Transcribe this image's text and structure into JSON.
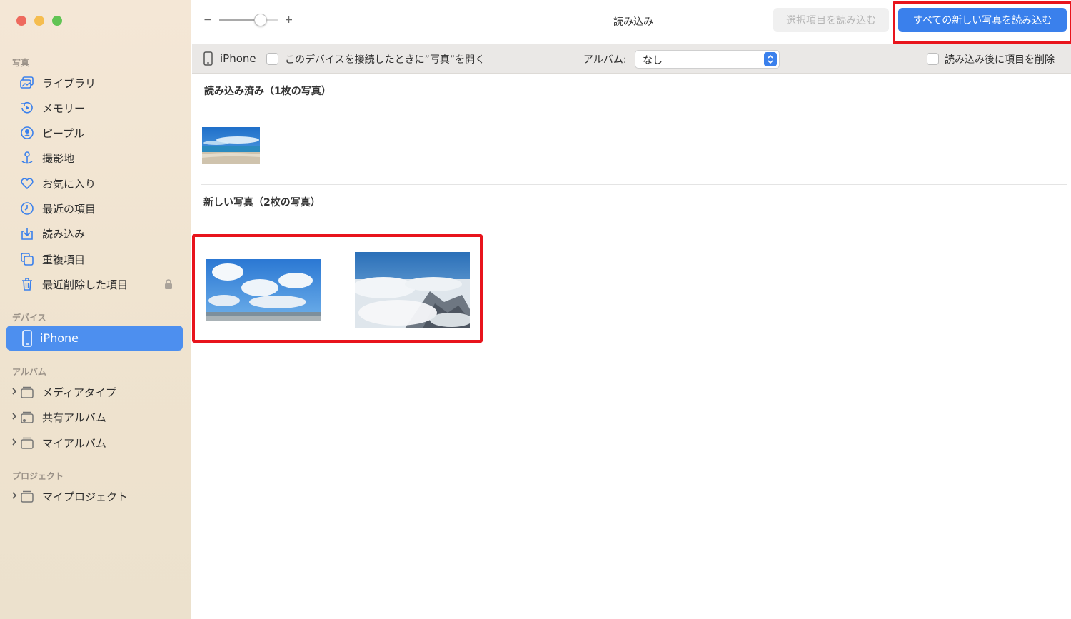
{
  "window": {
    "title": "読み込み"
  },
  "toolbar": {
    "zoom_minus": "−",
    "zoom_plus": "+",
    "zoom_level": 0.7,
    "import_selected_label": "選択項目を読み込む",
    "import_all_label": "すべての新しい写真を読み込む"
  },
  "sidebar": {
    "section_photos": "写真",
    "items": [
      {
        "label": "ライブラリ",
        "icon": "library-icon"
      },
      {
        "label": "メモリー",
        "icon": "memories-icon"
      },
      {
        "label": "ピープル",
        "icon": "people-icon"
      },
      {
        "label": "撮影地",
        "icon": "places-icon"
      },
      {
        "label": "お気に入り",
        "icon": "heart-icon"
      },
      {
        "label": "最近の項目",
        "icon": "clock-icon"
      },
      {
        "label": "読み込み",
        "icon": "import-icon"
      },
      {
        "label": "重複項目",
        "icon": "duplicates-icon"
      },
      {
        "label": "最近削除した項目",
        "icon": "trash-icon"
      }
    ],
    "section_devices": "デバイス",
    "device": {
      "label": "iPhone"
    },
    "section_albums": "アルバム",
    "albums": [
      {
        "label": "メディアタイプ"
      },
      {
        "label": "共有アルバム"
      },
      {
        "label": "マイアルバム"
      }
    ],
    "section_projects": "プロジェクト",
    "projects": [
      {
        "label": "マイプロジェクト"
      }
    ]
  },
  "device_bar": {
    "device_name": "iPhone",
    "open_photos_label": "このデバイスを接続したときに”写真”を開く",
    "album_label": "アルバム:",
    "album_value": "なし",
    "delete_after_import_label": "読み込み後に項目を削除"
  },
  "content": {
    "imported_title": "読み込み済み（1枚の写真）",
    "new_title": "新しい写真（2枚の写真）"
  },
  "colors": {
    "accent": "#3a80ec",
    "highlight": "#e8141c",
    "sidebar_bg": "#f0e4d1"
  }
}
